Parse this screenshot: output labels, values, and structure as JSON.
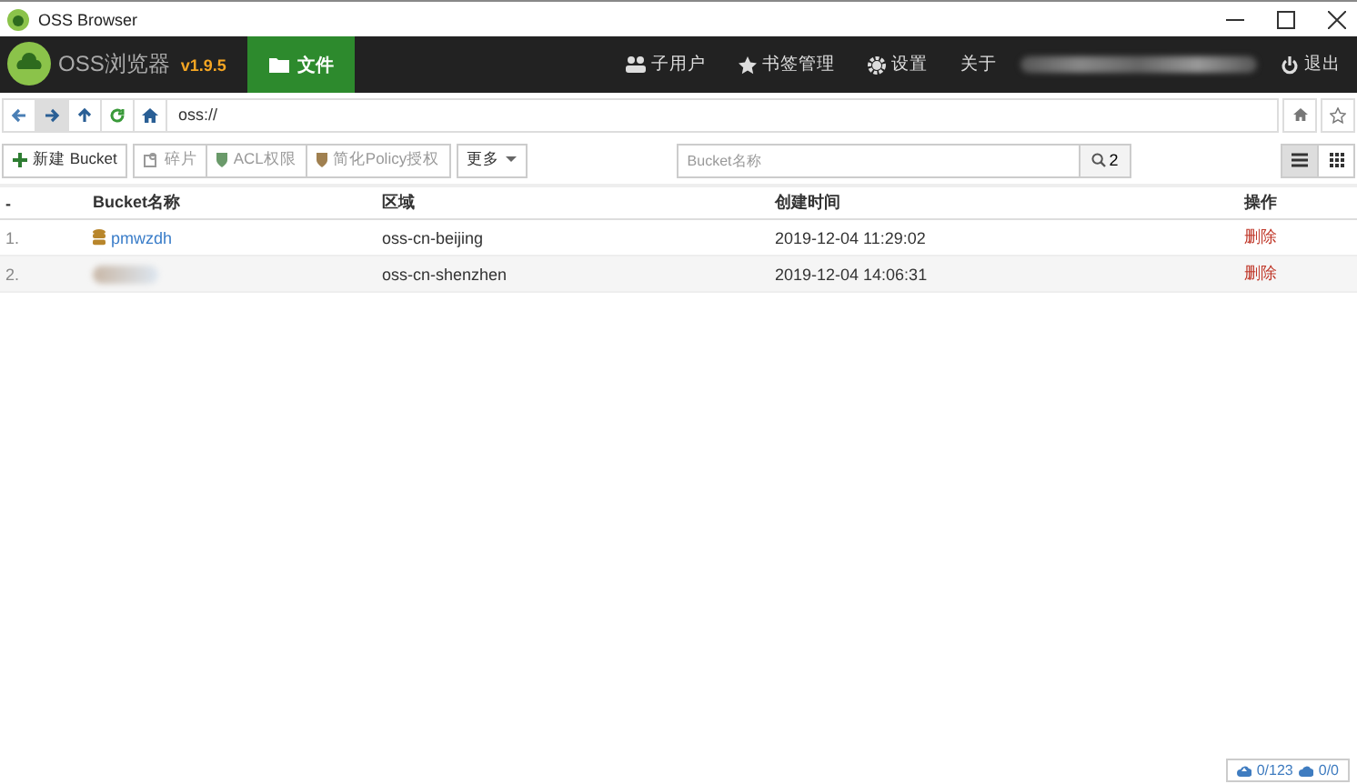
{
  "window": {
    "title": "OSS Browser"
  },
  "header": {
    "app_name": "OSS浏览器",
    "version": "v1.9.5",
    "tabs": [
      {
        "label": "文件",
        "selected": true
      }
    ],
    "menu": [
      {
        "label": "子用户",
        "kind": "users"
      },
      {
        "label": "书签管理",
        "kind": "bookmarks"
      },
      {
        "label": "设置",
        "kind": "settings"
      },
      {
        "label": "关于",
        "kind": "about"
      }
    ],
    "logout": "退出"
  },
  "address": {
    "value": "oss://"
  },
  "toolbar": {
    "buttons": [
      {
        "label": "新建 Bucket",
        "kind": "create",
        "disabled": false
      },
      {
        "label": "碎片",
        "kind": "fragments",
        "disabled": true
      },
      {
        "label": "ACL权限",
        "kind": "acl",
        "disabled": true
      },
      {
        "label": "简化Policy授权",
        "kind": "policy",
        "disabled": true
      },
      {
        "label": "更多",
        "kind": "more",
        "disabled": false
      }
    ],
    "search": {
      "placeholder": "Bucket名称",
      "count": "2"
    },
    "views": [
      {
        "kind": "list",
        "selected": true
      },
      {
        "kind": "grid",
        "selected": false
      }
    ]
  },
  "table": {
    "columns": [
      "-",
      "Bucket名称",
      "区域",
      "创建时间",
      "操作"
    ],
    "rows": [
      {
        "index": "1.",
        "name": "pmwzdh",
        "region": "oss-cn-beijing",
        "created": "2019-12-04 11:29:02",
        "action": "删除"
      },
      {
        "index": "2.",
        "region": "oss-cn-shenzhen",
        "created": "2019-12-04 14:06:31",
        "action": "删除"
      }
    ]
  },
  "status": {
    "uploads": "0/123",
    "downloads": "0/0"
  }
}
